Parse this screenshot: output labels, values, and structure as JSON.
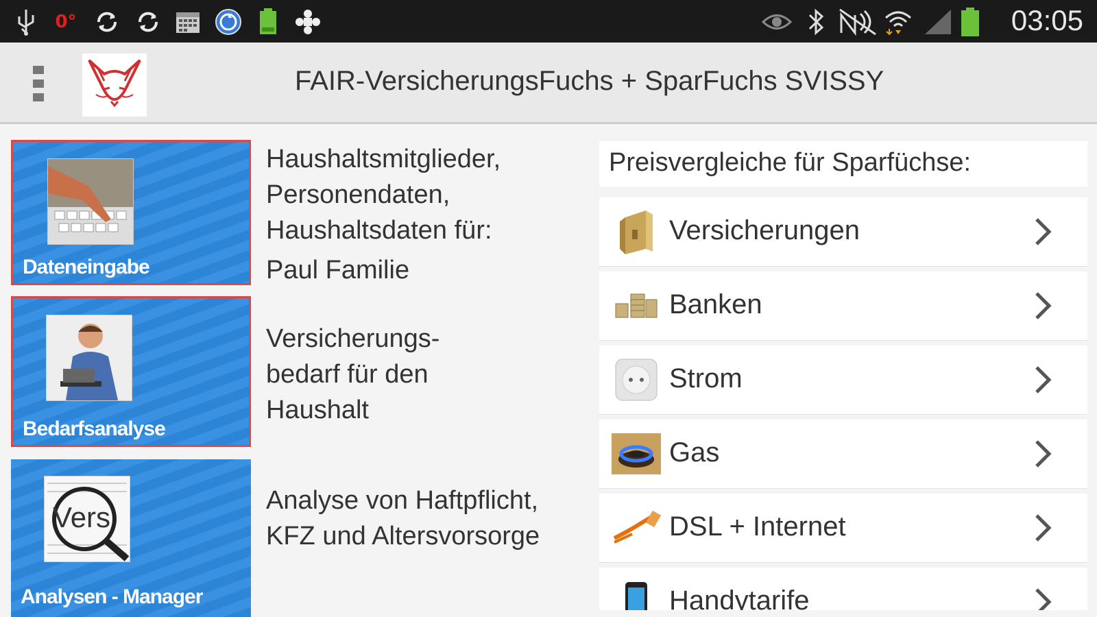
{
  "status_bar": {
    "time": "03:05",
    "left_icons": [
      "usb-icon",
      "notification-icon",
      "sync-icon",
      "sync-icon",
      "calendar-icon",
      "app-icon",
      "battery-notification-icon",
      "gamepad-icon"
    ],
    "right_icons": [
      "eye-icon",
      "bluetooth-icon",
      "nfc-icon",
      "wifi-icon",
      "signal-icon",
      "battery-icon"
    ]
  },
  "action_bar": {
    "title": "FAIR-VersicherungsFuchs + SparFuchs SVISSY",
    "logo_icon": "fox-logo-icon",
    "menu_icon": "overflow-menu-icon"
  },
  "tiles": [
    {
      "label": "Dateneingabe",
      "description": "Haushaltsmitglieder, Personendaten, Haushaltsdaten für:",
      "description_name": "Paul Familie",
      "icon": "typing-hand-icon"
    },
    {
      "label": "Bedarfsanalyse",
      "description": "Versicherungs-bedarf für den Haushalt",
      "icon": "man-at-laptop-icon"
    },
    {
      "label": "Analysen - Manager",
      "description": "Analyse von Haftpflicht, KFZ und Altersvorsorge",
      "icon": "magnifier-icon",
      "thumb_text": "Vers"
    }
  ],
  "price_compare": {
    "header": "Preisvergleiche für Sparfüchse:",
    "items": [
      {
        "label": "Versicherungen",
        "icon": "folder-icon"
      },
      {
        "label": "Banken",
        "icon": "coins-icon"
      },
      {
        "label": "Strom",
        "icon": "power-socket-icon"
      },
      {
        "label": "Gas",
        "icon": "gas-flame-icon"
      },
      {
        "label": "DSL + Internet",
        "icon": "cable-icon"
      },
      {
        "label": "Handytarife",
        "icon": "phone-icon"
      }
    ]
  },
  "colors": {
    "tile_blue": "#2e8ae0",
    "selection_red": "#d74a4a",
    "status_bar": "#1a1a1a",
    "action_bar": "#e9e9e9"
  }
}
